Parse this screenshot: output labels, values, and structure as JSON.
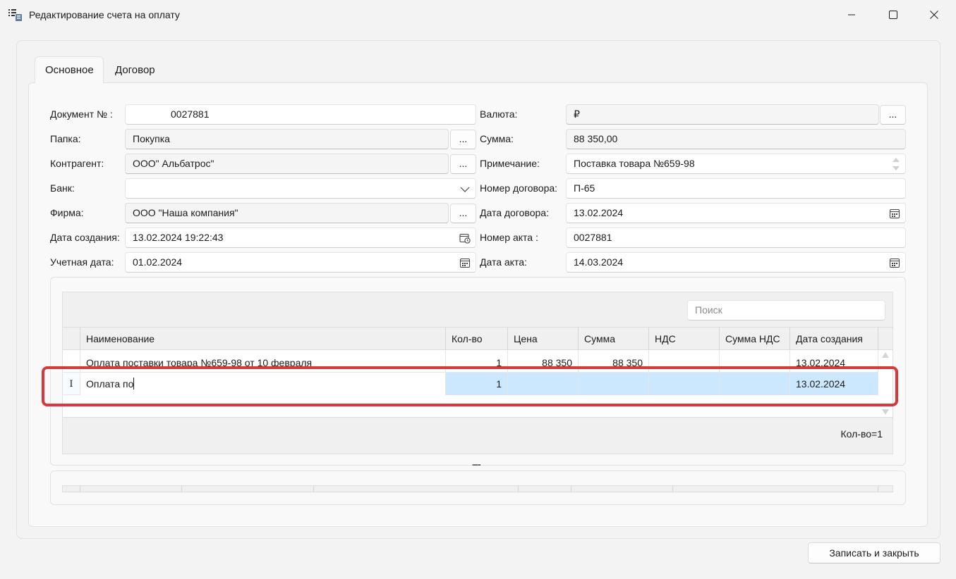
{
  "window": {
    "title": "Редактирование счета на оплату"
  },
  "tabs": [
    {
      "label": "Основное",
      "active": true
    },
    {
      "label": "Договор",
      "active": false
    }
  ],
  "left_form": {
    "doc_no_label": "Документ № :",
    "doc_no_value": "0027881",
    "folder_label": "Папка:",
    "folder_value": "Покупка",
    "counterparty_label": "Контрагент:",
    "counterparty_value": "ООО\" Альбатрос\"",
    "bank_label": "Банк:",
    "bank_value": "",
    "firm_label": "Фирма:",
    "firm_value": "ООО \"Наша компания\"",
    "created_label": "Дата создания:",
    "created_value": "13.02.2024 19:22:43",
    "account_date_label": "Учетная дата:",
    "account_date_value": "01.02.2024",
    "dots": "..."
  },
  "right_form": {
    "currency_label": "Валюта:",
    "currency_value": "₽",
    "sum_label": "Сумма:",
    "sum_value": "88 350,00",
    "note_label": "Примечание:",
    "note_value": "Поставка товара  №659-98",
    "contract_no_label": "Номер договора:",
    "contract_no_value": "П-65",
    "contract_date_label": "Дата договора:",
    "contract_date_value": "13.02.2024",
    "act_no_label": "Номер акта :",
    "act_no_value": "0027881",
    "act_date_label": "Дата акта:",
    "act_date_value": "14.03.2024"
  },
  "grid": {
    "search_placeholder": "Поиск",
    "columns": [
      "Наименование",
      "Кол-во",
      "Цена",
      "Сумма",
      "НДС",
      "Сумма НДС",
      "Дата создания"
    ],
    "rows": [
      {
        "name": "Оплата поставки товара №659-98 от 10 февраля",
        "qty": "1",
        "price": "88 350",
        "sum": "88 350",
        "vat": "",
        "vat_sum": "",
        "date": "13.02.2024"
      },
      {
        "name": "Оплата по",
        "qty": "1",
        "price": "",
        "sum": "",
        "vat": "",
        "vat_sum": "",
        "date": "13.02.2024",
        "editing": true,
        "row_marker": "I"
      }
    ],
    "footer": "Кол-во=1",
    "splitter": "....."
  },
  "buttons": {
    "save_close": "Записать и закрыть"
  },
  "colors": {
    "selection": "#cce8ff",
    "highlight": "#d9383a"
  }
}
